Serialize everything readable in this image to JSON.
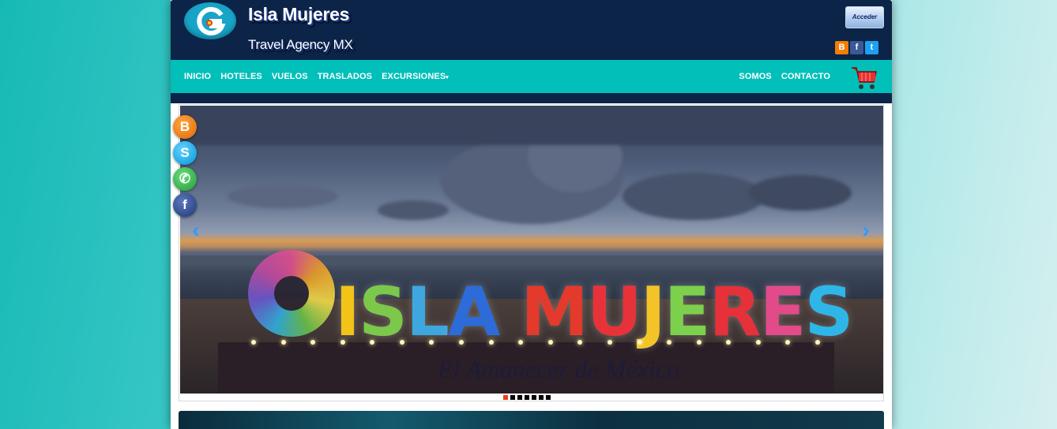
{
  "header": {
    "title": "Isla Mujeres",
    "subtitle": "Travel Agency MX",
    "login_label": "Acceder",
    "social_top": [
      {
        "icon": "blogger-icon",
        "glyph": "B",
        "color": "#f57d00"
      },
      {
        "icon": "facebook-icon",
        "glyph": "f",
        "color": "#3b5998"
      },
      {
        "icon": "twitter-icon",
        "glyph": "t",
        "color": "#1da1f2"
      }
    ]
  },
  "nav": {
    "left": [
      "INICIO",
      "HOTELES",
      "VUELOS",
      "TRASLADOS",
      "EXCURSIONES"
    ],
    "right": [
      "SOMOS",
      "CONTACTO"
    ],
    "dropdown_caret": "▾",
    "cart_icon": "shopping-cart-icon"
  },
  "carousel": {
    "slide_text": "ISLA MUJERES",
    "slide_subtext": "El Amanecer de México",
    "prev_glyph": "‹",
    "next_glyph": "›",
    "slide_count": 7,
    "active_slide": 1
  },
  "side_social": [
    {
      "icon": "blogger-icon",
      "glyph": "B",
      "color": "#f57d00"
    },
    {
      "icon": "skype-icon",
      "glyph": "S",
      "color": "#00aff0"
    },
    {
      "icon": "whatsapp-icon",
      "glyph": "✆",
      "color": "#2fb84a"
    },
    {
      "icon": "facebook-icon",
      "glyph": "f",
      "color": "#2d4a8a"
    }
  ],
  "colors": {
    "header_bg": "#0b2447",
    "nav_bg": "#01bfb9",
    "accent_arrow": "#3399ff",
    "active_dot": "#e8401c"
  }
}
